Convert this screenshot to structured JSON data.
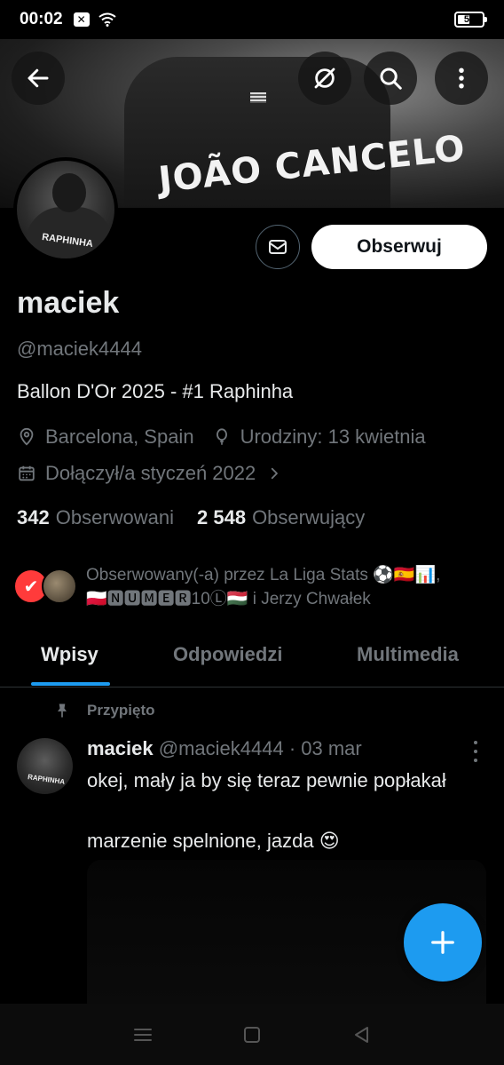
{
  "status_bar": {
    "time": "00:02",
    "battery": "51",
    "battery_level": 0.51
  },
  "banner": {
    "jersey_text": "JOÃO CANCELO"
  },
  "avatar": {
    "jersey_text": "RAPHINHA"
  },
  "profile": {
    "follow_label": "Obserwuj",
    "display_name": "maciek",
    "handle": "@maciek4444",
    "bio": "Ballon D'Or 2025 - #1 Raphinha",
    "location": "Barcelona, Spain",
    "birthday": "Urodziny: 13 kwietnia",
    "joined": "Dołączył/a styczeń 2022",
    "following_count": "342",
    "following_label": "Obserwowani",
    "followers_count": "2 548",
    "followers_label": "Obserwujący",
    "followed_by_line1": "Obserwowany(-a) przez La Liga Stats ⚽🇪🇸📊,",
    "followed_by_line2": "🇵🇱🅽🆄🅼🅴🆁10Ⓛ🇭🇺 i Jerzy Chwałek"
  },
  "tabs": [
    {
      "label": "Wpisy",
      "active": true
    },
    {
      "label": "Odpowiedzi",
      "active": false
    },
    {
      "label": "Multimedia",
      "active": false
    }
  ],
  "post": {
    "pinned_label": "Przypięto",
    "author_name": "maciek",
    "author_handle_date": "@maciek4444 · 03 mar",
    "text": "okej, mały ja by się teraz pewnie popłakał\n\nmarzenie spelnione, jazda 😍",
    "avatar_text": "RAPHINHA"
  },
  "colors": {
    "accent": "#1d9bf0",
    "muted": "#71767b",
    "text": "#e7e9ea",
    "background": "#000000"
  },
  "icons": {
    "back": "arrow-left-icon",
    "grok": "grok-icon",
    "search": "search-icon",
    "more": "more-vertical-icon",
    "message": "envelope-icon",
    "location": "location-pin-icon",
    "birthday": "balloon-icon",
    "calendar": "calendar-icon",
    "pin": "pin-icon",
    "compose": "plus-icon"
  }
}
